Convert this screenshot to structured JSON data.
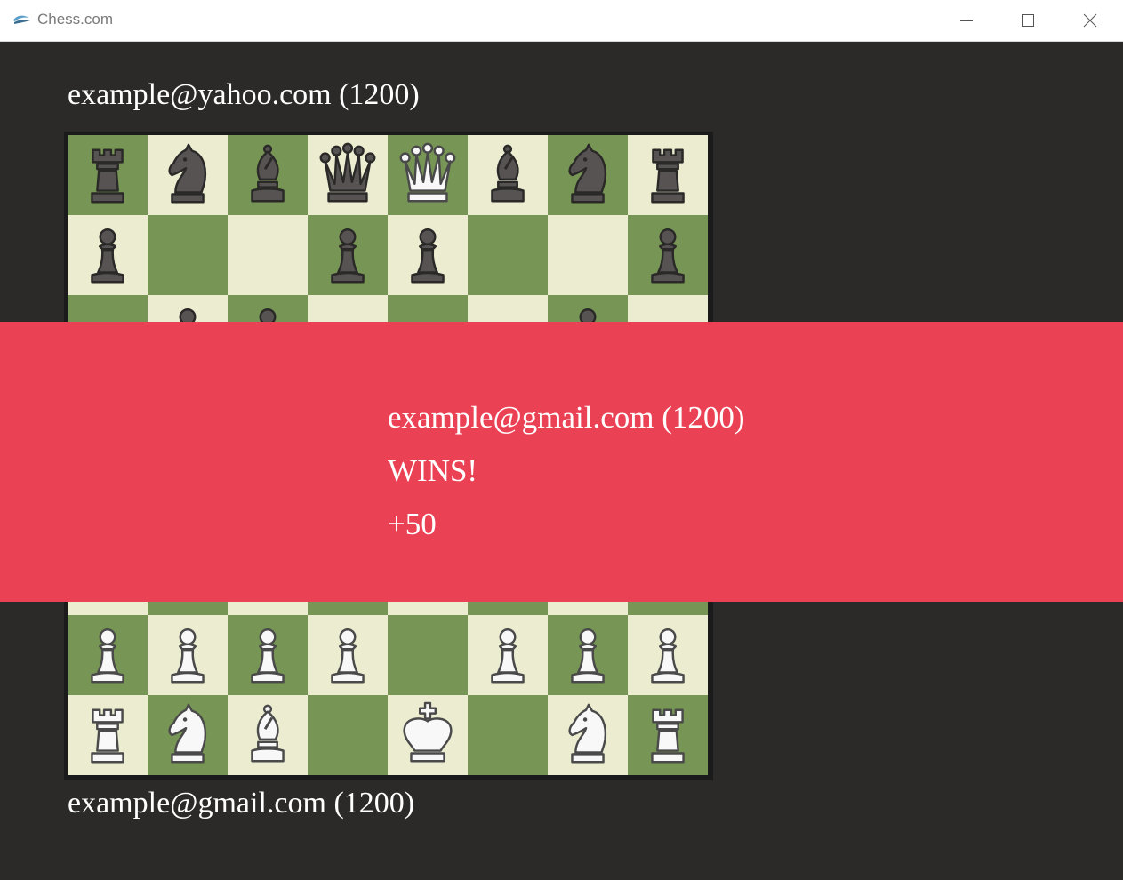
{
  "window": {
    "title": "Chess.com",
    "icon": "chess-com-pawn-icon"
  },
  "players": {
    "top": "example@yahoo.com (1200)",
    "bottom": "example@gmail.com (1200)"
  },
  "result": {
    "winner": "example@gmail.com (1200)",
    "status": "WINS!",
    "points": "+50"
  },
  "colors": {
    "dark_square": "#779555",
    "light_square": "#ebecd0",
    "banner": "#eb4154",
    "background": "#2b2a28"
  },
  "board": {
    "rows": [
      [
        "bR",
        "bN",
        "bB",
        "bQ",
        "wQ",
        "bB",
        "bN",
        "bR"
      ],
      [
        "bP",
        "",
        "",
        "bP",
        "bP",
        "",
        "",
        "bP"
      ],
      [
        "",
        "bP",
        "bP",
        "",
        "",
        "",
        "bP",
        ""
      ],
      [
        "",
        "",
        "",
        "",
        "",
        "",
        "",
        ""
      ],
      [
        "",
        "",
        "",
        "",
        "",
        "",
        "",
        ""
      ],
      [
        "",
        "",
        "",
        "",
        "",
        "",
        "",
        ""
      ],
      [
        "wP",
        "wP",
        "wP",
        "wP",
        "",
        "wP",
        "wP",
        "wP"
      ],
      [
        "wR",
        "wN",
        "wB",
        "",
        "wK",
        "",
        "wN",
        "wR"
      ]
    ]
  }
}
